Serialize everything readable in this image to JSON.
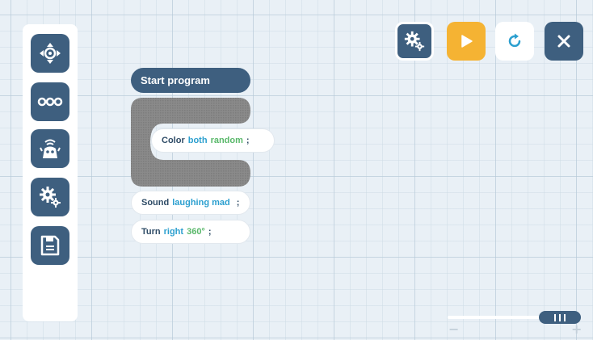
{
  "palette": {
    "items": [
      {
        "icon": "dpad-icon"
      },
      {
        "icon": "dots-icon"
      },
      {
        "icon": "robot-icon"
      },
      {
        "icon": "gears-icon"
      },
      {
        "icon": "save-icon"
      }
    ]
  },
  "program": {
    "start_label": "Start program",
    "color_block": {
      "keyword": "Color",
      "arg1": "both",
      "arg2": "random",
      "terminator": ";"
    },
    "sound_block": {
      "keyword": "Sound",
      "arg1": "laughing mad",
      "terminator": ";"
    },
    "turn_block": {
      "keyword": "Turn",
      "arg1": "right",
      "arg2": "360°",
      "terminator": ";"
    }
  },
  "toolbar": {
    "settings_icon": "gears-icon",
    "play_icon": "play-icon",
    "reset_icon": "refresh-icon",
    "close_icon": "close-icon"
  },
  "zoom": {
    "minus_label": "−",
    "plus_label": "+",
    "level": 1.0
  },
  "colors": {
    "navy": "#3e5f7f",
    "play": "#f5b333",
    "arg_blue": "#2b9fcf",
    "arg_green": "#59b86a",
    "loop_gray": "#888888"
  }
}
